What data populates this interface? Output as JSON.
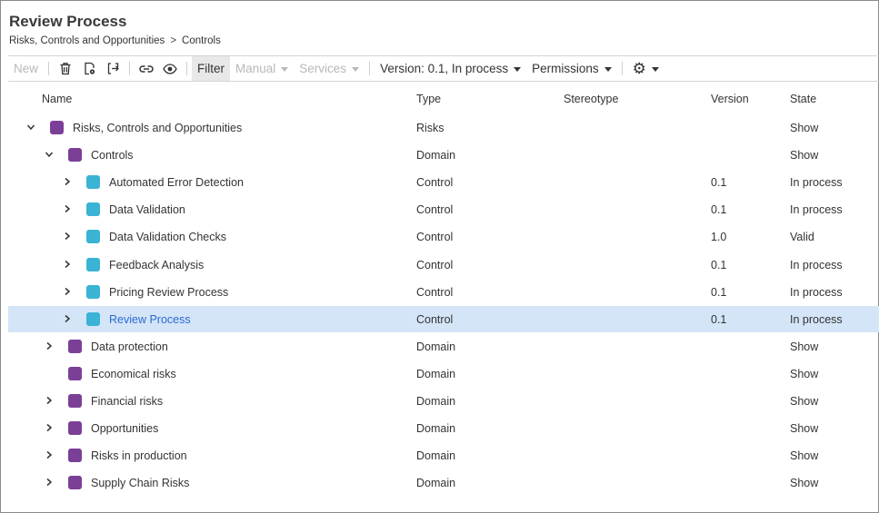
{
  "page": {
    "title": "Review Process",
    "breadcrumb": [
      "Risks, Controls and Opportunities",
      "Controls"
    ],
    "breadcrumb_sep": ">"
  },
  "toolbar": {
    "new_label": "New",
    "filter_label": "Filter",
    "manual_label": "Manual",
    "services_label": "Services",
    "version_label": "Version: 0.1, In process",
    "permissions_label": "Permissions",
    "icons": [
      "trash-icon",
      "document-settings-icon",
      "move-icon",
      "link-icon",
      "eye-icon",
      "gear-icon"
    ]
  },
  "columns": {
    "name": "Name",
    "type": "Type",
    "stereotype": "Stereotype",
    "version": "Version",
    "state": "State"
  },
  "colors": {
    "domain": "#7b3f98",
    "control": "#3ab3d4",
    "selected_row": "#d4e5f8",
    "selected_text": "#2a6bd1"
  },
  "rows": [
    {
      "name": "Risks, Controls and Opportunities",
      "type": "Risks",
      "stereotype": "",
      "version": "",
      "state": "Show",
      "level": 0,
      "expander": "expanded",
      "kind": "domain",
      "selected": false
    },
    {
      "name": "Controls",
      "type": "Domain",
      "stereotype": "",
      "version": "",
      "state": "Show",
      "level": 1,
      "expander": "expanded",
      "kind": "domain",
      "selected": false
    },
    {
      "name": "Automated Error Detection",
      "type": "Control",
      "stereotype": "",
      "version": "0.1",
      "state": "In process",
      "level": 2,
      "expander": "collapsed",
      "kind": "control",
      "selected": false
    },
    {
      "name": "Data Validation",
      "type": "Control",
      "stereotype": "",
      "version": "0.1",
      "state": "In process",
      "level": 2,
      "expander": "collapsed",
      "kind": "control",
      "selected": false
    },
    {
      "name": "Data Validation Checks",
      "type": "Control",
      "stereotype": "",
      "version": "1.0",
      "state": "Valid",
      "level": 2,
      "expander": "collapsed",
      "kind": "control",
      "selected": false
    },
    {
      "name": "Feedback Analysis",
      "type": "Control",
      "stereotype": "",
      "version": "0.1",
      "state": "In process",
      "level": 2,
      "expander": "collapsed",
      "kind": "control",
      "selected": false
    },
    {
      "name": "Pricing Review Process",
      "type": "Control",
      "stereotype": "",
      "version": "0.1",
      "state": "In process",
      "level": 2,
      "expander": "collapsed",
      "kind": "control",
      "selected": false
    },
    {
      "name": "Review Process",
      "type": "Control",
      "stereotype": "",
      "version": "0.1",
      "state": "In process",
      "level": 2,
      "expander": "collapsed",
      "kind": "control",
      "selected": true
    },
    {
      "name": "Data protection",
      "type": "Domain",
      "stereotype": "",
      "version": "",
      "state": "Show",
      "level": 1,
      "expander": "collapsed",
      "kind": "domain",
      "selected": false
    },
    {
      "name": "Economical risks",
      "type": "Domain",
      "stereotype": "",
      "version": "",
      "state": "Show",
      "level": 1,
      "expander": "none",
      "kind": "domain",
      "selected": false
    },
    {
      "name": "Financial risks",
      "type": "Domain",
      "stereotype": "",
      "version": "",
      "state": "Show",
      "level": 1,
      "expander": "collapsed",
      "kind": "domain",
      "selected": false
    },
    {
      "name": "Opportunities",
      "type": "Domain",
      "stereotype": "",
      "version": "",
      "state": "Show",
      "level": 1,
      "expander": "collapsed",
      "kind": "domain",
      "selected": false
    },
    {
      "name": "Risks in production",
      "type": "Domain",
      "stereotype": "",
      "version": "",
      "state": "Show",
      "level": 1,
      "expander": "collapsed",
      "kind": "domain",
      "selected": false
    },
    {
      "name": "Supply Chain Risks",
      "type": "Domain",
      "stereotype": "",
      "version": "",
      "state": "Show",
      "level": 1,
      "expander": "collapsed",
      "kind": "domain",
      "selected": false
    }
  ]
}
